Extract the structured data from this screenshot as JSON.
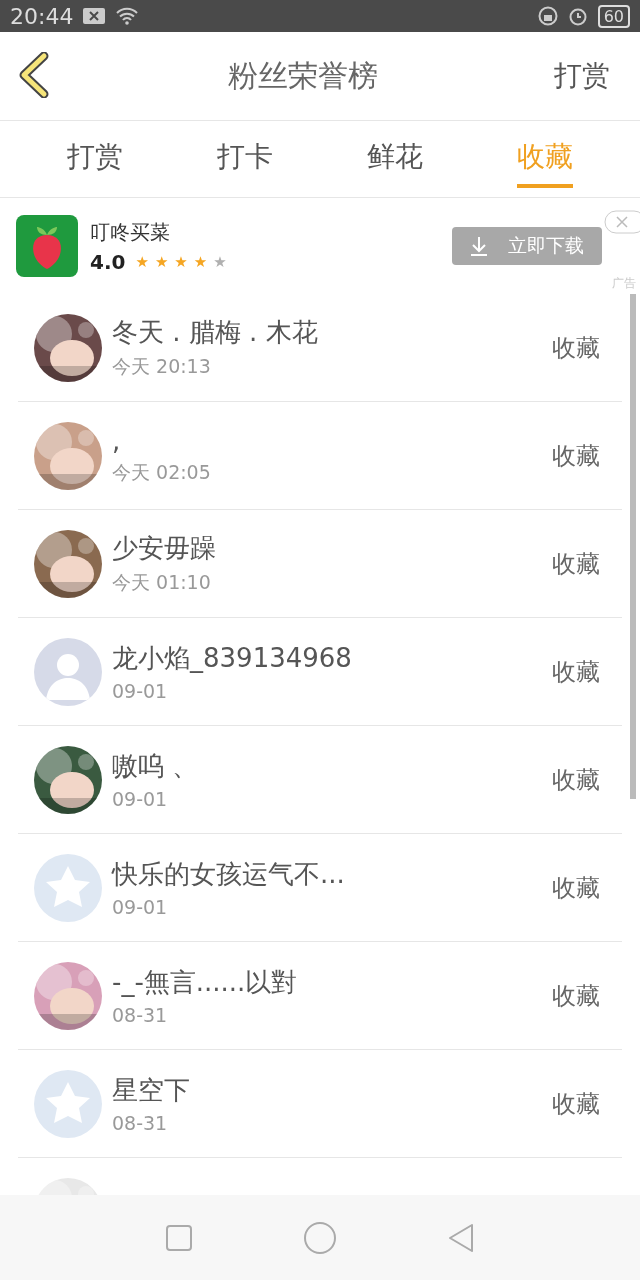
{
  "status_bar": {
    "time": "20:44",
    "battery": "60"
  },
  "header": {
    "title": "粉丝荣誉榜",
    "action": "打赏"
  },
  "tabs": [
    {
      "label": "打赏",
      "selected": false
    },
    {
      "label": "打卡",
      "selected": false
    },
    {
      "label": "鲜花",
      "selected": false
    },
    {
      "label": "收藏",
      "selected": true
    }
  ],
  "ad": {
    "name": "叮咚买菜",
    "rating": "4.0",
    "stars": 4,
    "button": "立即下载",
    "tag": "广告"
  },
  "fans": [
    {
      "name": "冬天 . 腊梅 . 木花",
      "time": "今天 20:13",
      "action": "收藏",
      "kind": "picture"
    },
    {
      "name": ",",
      "time": "今天 02:05",
      "action": "收藏",
      "kind": "picture"
    },
    {
      "name": "少安毋躁",
      "time": "今天 01:10",
      "action": "收藏",
      "kind": "picture"
    },
    {
      "name": "龙小焰_839134968",
      "time": "09-01",
      "action": "收藏",
      "kind": "person"
    },
    {
      "name": "嗷呜 、",
      "time": "09-01",
      "action": "收藏",
      "kind": "picture"
    },
    {
      "name": "快乐的女孩运气不...",
      "time": "09-01",
      "action": "收藏",
      "kind": "star"
    },
    {
      "name": "-_-無言......以對",
      "time": "08-31",
      "action": "收藏",
      "kind": "picture"
    },
    {
      "name": "星空下",
      "time": "08-31",
      "action": "收藏",
      "kind": "star"
    },
    {
      "kind": "picture"
    }
  ]
}
